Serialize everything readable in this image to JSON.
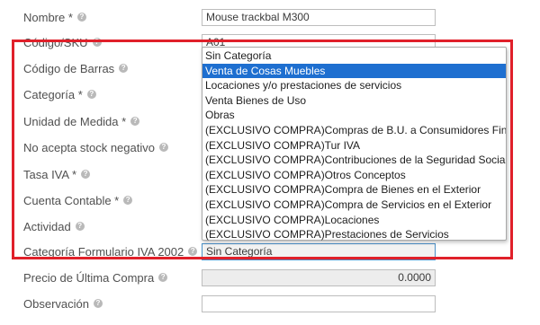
{
  "form": {
    "nombre_label": "Nombre *",
    "nombre_value": "Mouse trackbal M300",
    "codigo_label": "Código/SKU",
    "codigo_value": "A01",
    "barras_label": "Código de Barras",
    "categoria_label": "Categoría *",
    "unidad_label": "Unidad de Medida *",
    "stock_label": "No acepta stock negativo",
    "iva_label": "Tasa IVA *",
    "cuenta_label": "Cuenta Contable *",
    "actividad_label": "Actividad",
    "formulario_label": "Categoría Formulario IVA 2002",
    "formulario_value": "Sin Categoría",
    "precio_label": "Precio de Última Compra",
    "precio_value": "0.0000",
    "observacion_label": "Observación",
    "observacion_value": ""
  },
  "icons": {
    "help": "question-circle-icon",
    "help_glyph": "?"
  },
  "dropdown": {
    "selected_index": 1,
    "options": [
      "Sin Categoría",
      "Venta de Cosas Muebles",
      "Locaciones y/o prestaciones de servicios",
      "Venta Bienes de Uso",
      "Obras",
      "(EXCLUSIVO COMPRA)Compras de B.U. a Consumidores Finales",
      "(EXCLUSIVO COMPRA)Tur IVA",
      "(EXCLUSIVO COMPRA)Contribuciones de la Seguridad Social",
      "(EXCLUSIVO COMPRA)Otros Conceptos",
      "(EXCLUSIVO COMPRA)Compra de Bienes en el Exterior",
      "(EXCLUSIVO COMPRA)Compra de Servicios en el Exterior",
      "(EXCLUSIVO COMPRA)Locaciones",
      "(EXCLUSIVO COMPRA)Prestaciones de Servicios"
    ]
  },
  "colors": {
    "highlight_border": "#e0202a",
    "selected_option_bg": "#1e6fd0",
    "help_icon": "#b9b9b9",
    "disabled_field_bg": "#ededed"
  }
}
